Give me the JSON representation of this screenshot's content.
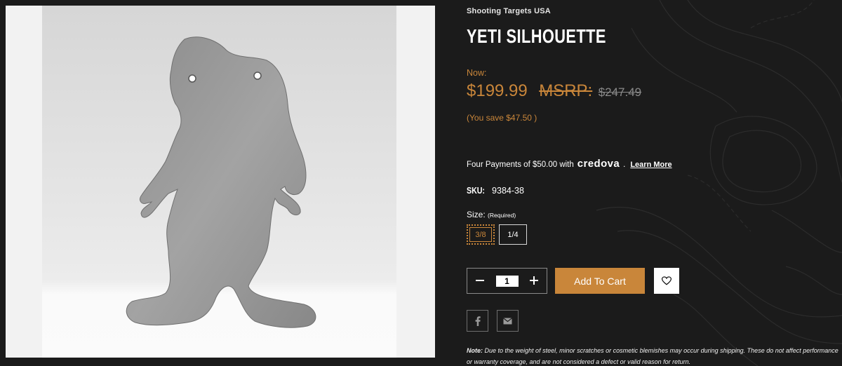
{
  "product": {
    "brand": "Shooting Targets USA",
    "title": "YETI SILHOUETTE",
    "now_label": "Now:",
    "price": "$199.99",
    "msrp_label": "MSRP:",
    "msrp_price": "$247.49",
    "savings": "(You save $47.50 )",
    "payments_text": "Four Payments of $50.00 with",
    "payments_brand": "credova",
    "payments_dot": ".",
    "learn_more": "Learn More",
    "sku_label": "SKU:",
    "sku_value": "9384-38",
    "size_label": "Size:",
    "size_required": "(Required)",
    "sizes": [
      "3/8",
      "1/4"
    ],
    "selected_size": "3/8",
    "quantity": "1",
    "add_to_cart": "Add To Cart",
    "note_prefix": "Note:",
    "note_text": "Due to the weight of steel, minor scratches or cosmetic blemishes may occur during shipping. These do not affect performance or warranty coverage, and are not considered a defect or valid reason for return."
  },
  "icons": {
    "decrement": "minus-icon",
    "increment": "plus-icon",
    "wishlist": "heart-icon",
    "facebook": "facebook-icon",
    "email": "email-icon"
  },
  "colors": {
    "accent": "#c9863a",
    "background": "#1b1b1b",
    "text": "#ffffff",
    "muted": "#8a8a8a"
  }
}
